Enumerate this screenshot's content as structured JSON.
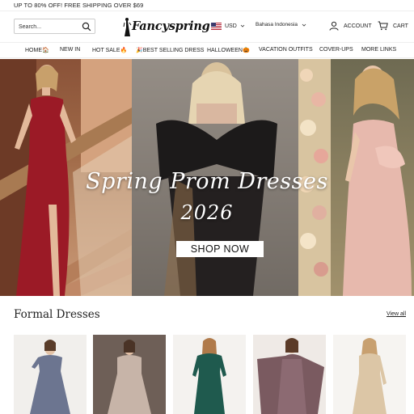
{
  "promo": {
    "text": "UP TO 80% OFF! FREE SHIPPING OVER $69"
  },
  "header": {
    "search_placeholder": "Search...",
    "logo": "Fancyspring",
    "currency": "USD",
    "language": "Bahasa Indonesia",
    "account_label": "ACCOUNT",
    "cart_label": "CART"
  },
  "nav": {
    "items": [
      {
        "label": "HOME🏠"
      },
      {
        "label": "NEW IN"
      },
      {
        "label": "HOT SALE🔥"
      },
      {
        "label": "🎉BEST SELLING DRESS"
      },
      {
        "label": "HALLOWEEN🎃"
      },
      {
        "label": "VACATION OUTFITS"
      },
      {
        "label": "COVER-UPS"
      },
      {
        "label": "MORE LINKS"
      }
    ]
  },
  "hero": {
    "title_line1": "Spring Prom Dresses",
    "title_line2": "2026",
    "cta": "SHOP NOW"
  },
  "section": {
    "title": "Formal Dresses",
    "view_all": "View all"
  },
  "colors": {
    "red_dress": "#9b1a26",
    "black_dress": "#1c1a1a",
    "pink_dress": "#e7b9ad",
    "background": "#ffffff"
  }
}
